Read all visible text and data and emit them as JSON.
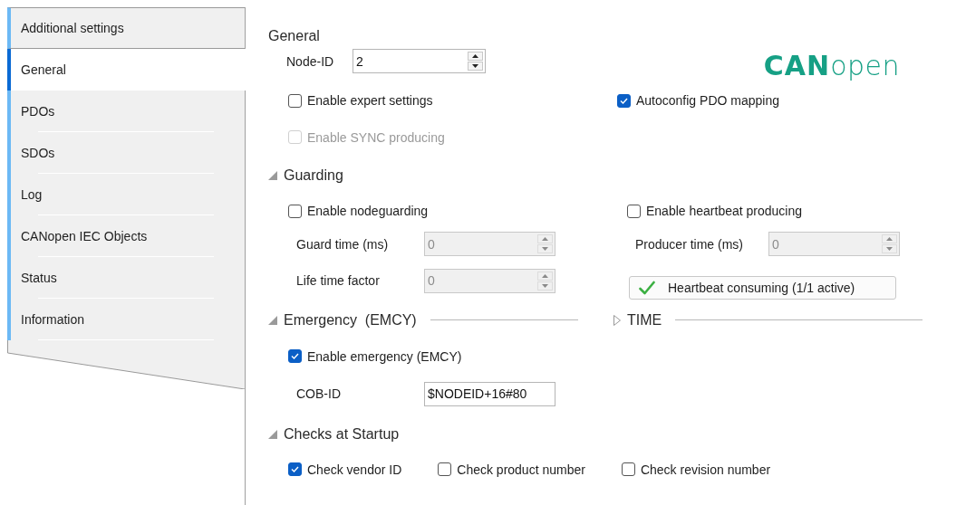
{
  "tabs": [
    {
      "label": "Additional settings",
      "selected": false
    },
    {
      "label": "General",
      "selected": true
    },
    {
      "label": "PDOs",
      "selected": false
    },
    {
      "label": "SDOs",
      "selected": false
    },
    {
      "label": "Log",
      "selected": false
    },
    {
      "label": "CANopen IEC Objects",
      "selected": false
    },
    {
      "label": "Status",
      "selected": false
    },
    {
      "label": "Information",
      "selected": false
    }
  ],
  "general": {
    "title": "General",
    "logo": "**CAN**open",
    "node_id": {
      "label": "Node-ID",
      "value": "2",
      "disabled": false
    },
    "options": [
      {
        "label": "Enable expert settings",
        "checked": false,
        "disabled": false
      },
      {
        "label": "Autoconfig PDO mapping",
        "checked": true,
        "disabled": false
      },
      {
        "label": "Enable SYNC producing",
        "checked": false,
        "disabled": true
      }
    ]
  },
  "guarding": {
    "title": "Guarding",
    "expanded": true,
    "nodeguarding": {
      "label": "Enable nodeguarding",
      "checked": false,
      "disabled": false
    },
    "heartbeat": {
      "label": "Enable heartbeat producing",
      "checked": false,
      "disabled": false
    },
    "guard_time": {
      "label": "Guard time (ms)",
      "value": "0",
      "disabled": true
    },
    "producer_time": {
      "label": "Producer time (ms)",
      "value": "0",
      "disabled": true
    },
    "life_time_factor": {
      "label": "Life time factor",
      "value": "0",
      "disabled": true
    },
    "heartbeat_consuming": {
      "label": "Heartbeat consuming (1/1 active)"
    }
  },
  "emergency": {
    "title": "Emergency  (EMCY)",
    "expanded": true,
    "enable": {
      "label": "Enable emergency (EMCY)",
      "checked": true,
      "disabled": false
    },
    "cob_id": {
      "label": "COB-ID",
      "value": "$NODEID+16#80",
      "disabled": false
    }
  },
  "time": {
    "title": "TIME",
    "expanded": false
  },
  "checks": {
    "title": "Checks at Startup",
    "expanded": true,
    "options": [
      {
        "label": "Check vendor ID",
        "checked": true,
        "disabled": false
      },
      {
        "label": "Check product number",
        "checked": false,
        "disabled": false
      },
      {
        "label": "Check revision number",
        "checked": false,
        "disabled": false
      }
    ]
  }
}
